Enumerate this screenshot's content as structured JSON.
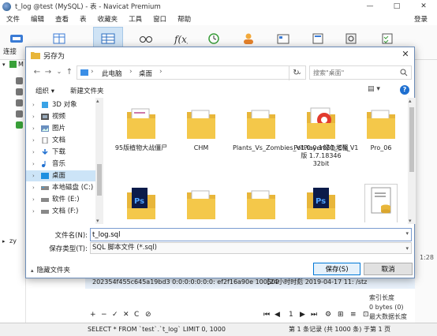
{
  "navicat": {
    "title": "t_log @test (MySQL) - 表 - Navicat Premium",
    "window_controls": [
      "—",
      "□",
      "✕"
    ],
    "menu": [
      "文件",
      "编辑",
      "查看",
      "表",
      "收藏夹",
      "工具",
      "窗口",
      "帮助"
    ],
    "login": "登录",
    "toolbar_label": "连接",
    "tree_marker": "M",
    "tree_label": "zy",
    "right_time": "1:28",
    "hex_cols": [
      "202354f455c645a19bd3 0:0:0:0:0:0:0: ef2f16a90e 100502",
      "【24小时时彪 2019-04-17 11: /stz"
    ],
    "grid_tools": [
      "+",
      "−",
      "✓",
      "✕",
      "C",
      "⊘"
    ],
    "pager": [
      "⏮",
      "◀",
      "1",
      "▶",
      "⏭",
      "⚙",
      "⊞",
      "≡",
      "⊡"
    ],
    "side_info": [
      "索引长度",
      "0 bytes (0)",
      "最大数据长度"
    ],
    "status_sql": "SELECT * FROM `test`.`t_log` LIMIT 0, 1000",
    "status_records": "第 1 条记录 (共 1000 条) 于第 1 页"
  },
  "dialog": {
    "title": "另存为",
    "close": "✕",
    "nav": {
      "back": "←",
      "forward": "→",
      "down": "⌄",
      "up": "↑",
      "refresh": "↻"
    },
    "breadcrumb": [
      "此电脑",
      "桌面"
    ],
    "search_placeholder": "搜索\"桌面\"",
    "organize": "组织 ▾",
    "new_folder": "新建文件夹",
    "view": "▤ ▾",
    "help": "?",
    "nav_items": [
      {
        "label": "3D 对象",
        "icon": "cube-icon"
      },
      {
        "label": "视频",
        "icon": "video-icon"
      },
      {
        "label": "图片",
        "icon": "picture-icon"
      },
      {
        "label": "文档",
        "icon": "document-icon"
      },
      {
        "label": "下载",
        "icon": "download-icon"
      },
      {
        "label": "音乐",
        "icon": "music-icon"
      },
      {
        "label": "桌面",
        "icon": "desktop-icon"
      },
      {
        "label": "本地磁盘 (C:)",
        "icon": "drive-icon"
      },
      {
        "label": "软件 (E:)",
        "icon": "drive-icon"
      },
      {
        "label": "文档 (F:)",
        "icon": "drive-icon"
      }
    ],
    "files": [
      {
        "label": "95版植物大战僵尸",
        "kind": "folder"
      },
      {
        "label": "CHM",
        "kind": "folder"
      },
      {
        "label": "Plants_Vs_Zombies_V1.0.0.1051_CN_V1",
        "kind": "folder"
      },
      {
        "label": "PotPlayer绿色增强版 1.7.18346 32bit",
        "kind": "folder"
      },
      {
        "label": "Pro_06",
        "kind": "folder"
      },
      {
        "label": "",
        "kind": "ps-folder"
      },
      {
        "label": "",
        "kind": "folder"
      },
      {
        "label": "",
        "kind": "folder"
      },
      {
        "label": "",
        "kind": "ps-folder"
      },
      {
        "label": "",
        "kind": "db-file"
      }
    ],
    "filename_label": "文件名(N):",
    "filename_value": "t_log.sql",
    "filetype_label": "保存类型(T):",
    "filetype_value": "SQL 脚本文件 (*.sql)",
    "hide_folders": "隐藏文件夹",
    "save": "保存(S)",
    "cancel": "取消"
  }
}
